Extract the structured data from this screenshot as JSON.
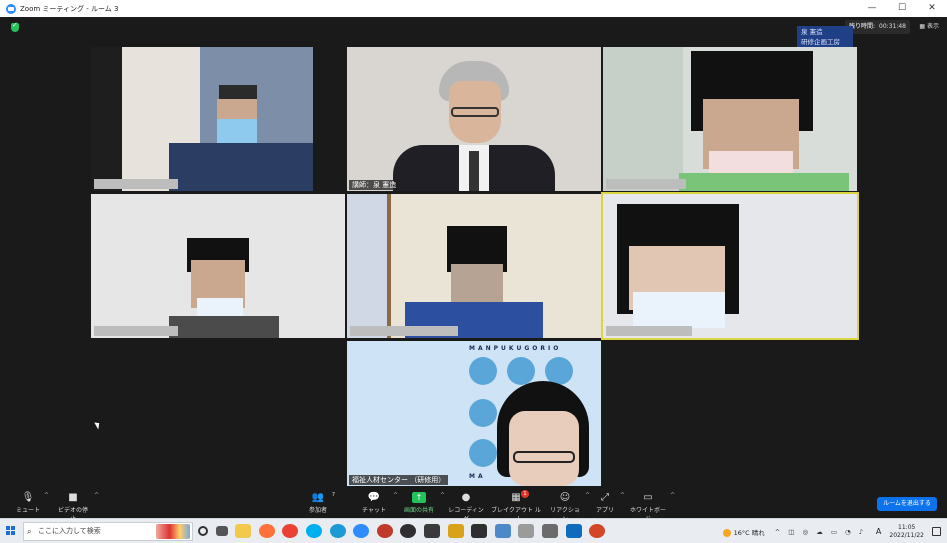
{
  "window": {
    "title": "Zoom ミーティング - ルーム 3",
    "controls": [
      "—",
      "☐",
      "✕"
    ]
  },
  "meeting": {
    "timer_label": "残り時間:",
    "timer_value": "00:31:48",
    "view_label": "表示",
    "room_badge_line1": "泉 憲造",
    "room_badge_line2": "研修企画工房"
  },
  "tiles": {
    "speaker_name": "講師：泉 憲造",
    "share_name": "福祉人材センター （研修用）",
    "share_banner_top": "MANPUKUGORIO",
    "share_banner_bottom": "MA"
  },
  "toolbar": {
    "mute": "ミュート",
    "video": "ビデオの停止",
    "participants": "参加者",
    "participants_count": "7",
    "chat": "チャット",
    "share": "画面の共有",
    "record": "レコーディング",
    "breakout": "ブレイクアウト ルーム",
    "breakout_badge": "1",
    "reactions": "リアクション",
    "apps": "アプリ",
    "whiteboard": "ホワイトボード",
    "leave": "ルームを退出する"
  },
  "taskbar": {
    "search_placeholder": "ここに入力して検索",
    "weather": "16°C 晴れ",
    "ime": "A",
    "time": "11:05",
    "date": "2022/11/22"
  },
  "colors": {
    "zoom_blue": "#2d8cff",
    "leave_blue": "#0e72ed",
    "active_speaker": "#d9d440",
    "share_green": "#25c15a",
    "badge_red": "#e0352b"
  }
}
